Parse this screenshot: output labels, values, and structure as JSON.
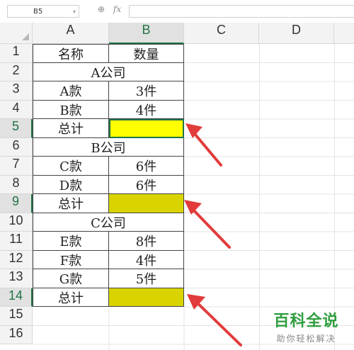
{
  "formula_bar": {
    "name_box": "B5",
    "zoom_icon": "zoom-icon",
    "fx_label": "fx",
    "formula_value": ""
  },
  "columns": [
    "A",
    "B",
    "C",
    "D"
  ],
  "active_column": "B",
  "rows": [
    "1",
    "2",
    "3",
    "4",
    "5",
    "6",
    "7",
    "8",
    "9",
    "10",
    "11",
    "12",
    "13",
    "14",
    "15",
    "16"
  ],
  "active_rows": [
    "5",
    "9",
    "14"
  ],
  "cells": {
    "r1": {
      "a": "名称",
      "b": "数量"
    },
    "r2": {
      "merged": "A公司"
    },
    "r3": {
      "a": "A款",
      "b": "3件"
    },
    "r4": {
      "a": "B款",
      "b": "4件"
    },
    "r5": {
      "a": "总计",
      "b": ""
    },
    "r6": {
      "merged": "B公司"
    },
    "r7": {
      "a": "C款",
      "b": "6件"
    },
    "r8": {
      "a": "D款",
      "b": "6件"
    },
    "r9": {
      "a": "总计",
      "b": ""
    },
    "r10": {
      "merged": "C公司"
    },
    "r11": {
      "a": "E款",
      "b": "8件"
    },
    "r12": {
      "a": "F款",
      "b": "4件"
    },
    "r13": {
      "a": "G款",
      "b": "5件"
    },
    "r14": {
      "a": "总计",
      "b": ""
    }
  },
  "colors": {
    "highlight_yellow": "#ffff00",
    "highlight_olive": "#d9d400",
    "arrow_red": "#e23b3b",
    "accent_green": "#217346",
    "watermark_green": "#2e9e3e"
  },
  "watermark": {
    "title": "百科全说",
    "subtitle": "助你轻松解决"
  }
}
